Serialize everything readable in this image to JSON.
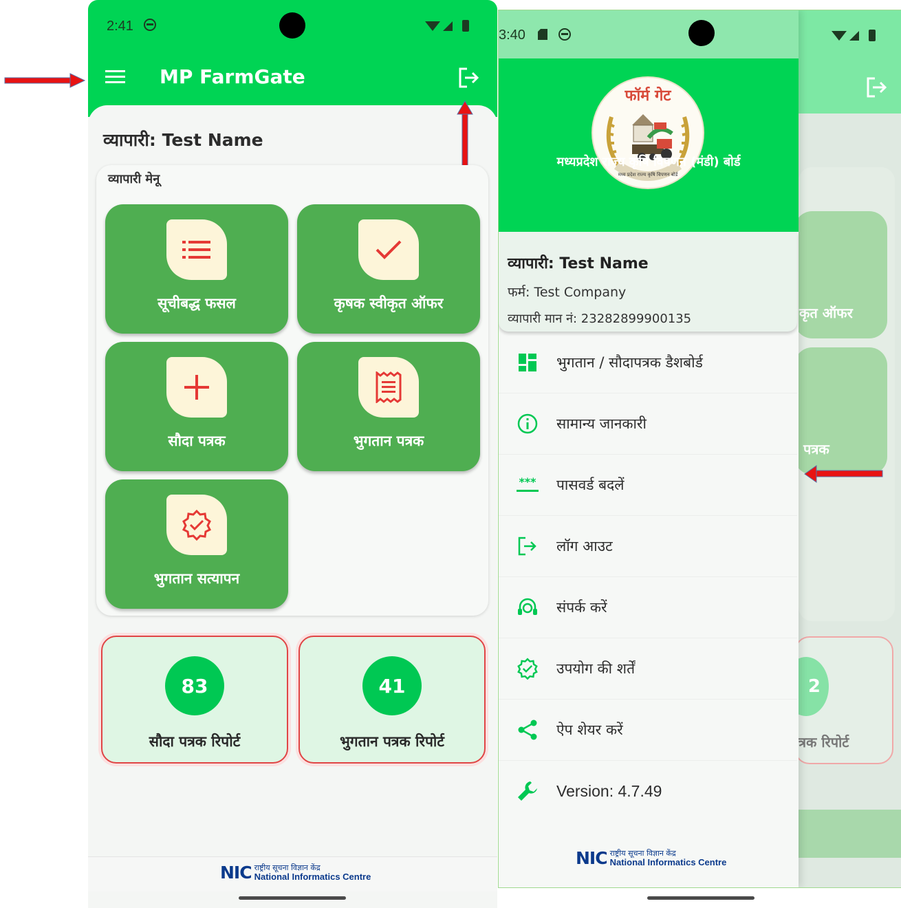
{
  "left_screen": {
    "status": {
      "time": "2:41"
    },
    "app_bar": {
      "title": "MP FarmGate"
    },
    "trader_heading": "व्यापारी: Test Name",
    "menu_title": "व्यापारी मेनू",
    "tiles": [
      {
        "label": "सूचीबद्ध फसल",
        "icon": "list-icon"
      },
      {
        "label": "कृषक स्वीकृत ऑफर",
        "icon": "check-icon"
      },
      {
        "label": "सौदा पत्रक",
        "icon": "plus-icon"
      },
      {
        "label": "भुगतान पत्रक",
        "icon": "receipt-icon"
      },
      {
        "label": "भुगतान सत्यापन",
        "icon": "verified-badge-icon"
      }
    ],
    "reports": [
      {
        "count": "83",
        "label": "सौदा पत्रक रिपोर्ट"
      },
      {
        "count": "41",
        "label": "भुगतान पत्रक रिपोर्ट"
      }
    ],
    "footer": {
      "nic_mark": "NIC",
      "nic_hindi": "राष्ट्रीय सूचना विज्ञान केंद्र",
      "nic_english": "National Informatics Centre"
    }
  },
  "right_screen": {
    "status": {
      "time": "3:40"
    },
    "logo_text": "फॉर्म गेट",
    "logo_ring_text": "मध्य प्रदेश राज्य कृषि विपणन बोर्ड",
    "board_title": "मध्यप्रदेश राज्य कृषि विपणन (मंडी) बोर्ड",
    "profile": {
      "name": "व्यापारी: Test Name",
      "firm": "फर्म: Test Company",
      "license": "व्यापारी मान नं: 23282899900135"
    },
    "drawer_items": [
      {
        "label": "भुगतान / सौदापत्रक डैशबोर्ड",
        "icon": "dashboard-icon"
      },
      {
        "label": "सामान्य जानकारी",
        "icon": "info-icon"
      },
      {
        "label": "पासवर्ड बदलें",
        "icon": "password-icon"
      },
      {
        "label": "लॉग आउट",
        "icon": "logout-icon"
      },
      {
        "label": "संपर्क करें",
        "icon": "support-agent-icon"
      },
      {
        "label": "उपयोग की शर्तें",
        "icon": "verified-badge-icon"
      },
      {
        "label": "ऐप शेयर करें",
        "icon": "share-icon"
      },
      {
        "label": "Version: 4.7.49",
        "icon": "wrench-icon"
      }
    ],
    "behind": {
      "tile_label_1": "कृत ऑफर",
      "tile_label_2": "पत्रक",
      "report_count": "2",
      "report_label": "त्रक रिपोर्ट"
    },
    "footer": {
      "nic_mark": "NIC",
      "nic_hindi": "राष्ट्रीय सूचना विज्ञान केंद्र",
      "nic_english": "National Informatics Centre"
    }
  },
  "colors": {
    "primary_green": "#00d454",
    "tile_green": "#4fae51",
    "accent_red": "#e81313",
    "report_circle": "#00c853"
  }
}
